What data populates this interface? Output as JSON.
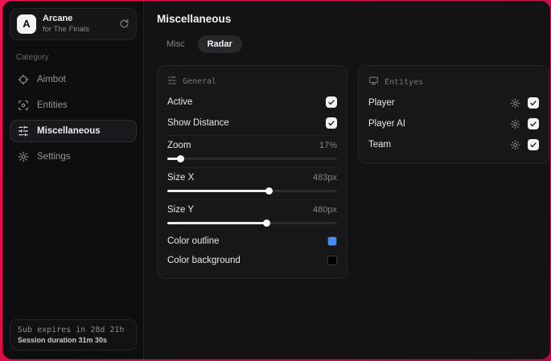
{
  "app": {
    "title": "Arcane",
    "subtitle": "for The Finals",
    "avatar_letter": "A"
  },
  "sidebar": {
    "category_label": "Category",
    "items": [
      {
        "label": "Aimbot",
        "icon": "crosshair-icon",
        "active": false
      },
      {
        "label": "Entities",
        "icon": "scan-icon",
        "active": false
      },
      {
        "label": "Miscellaneous",
        "icon": "sliders-icon",
        "active": true
      },
      {
        "label": "Settings",
        "icon": "gear-icon",
        "active": false
      }
    ],
    "footer": {
      "sub_expiry": "Sub expires in 28d 21h",
      "session_duration": "Session duration 31m 30s"
    }
  },
  "main": {
    "title": "Miscellaneous",
    "tabs": [
      {
        "label": "Misc",
        "active": false
      },
      {
        "label": "Radar",
        "active": true
      }
    ],
    "general": {
      "title": "General",
      "toggles": [
        {
          "label": "Active",
          "checked": true
        },
        {
          "label": "Show Distance",
          "checked": true
        }
      ],
      "sliders": [
        {
          "label": "Zoom",
          "value": "17%",
          "percent": 8
        },
        {
          "label": "Size X",
          "value": "483px",
          "percent": 60
        },
        {
          "label": "Size Y",
          "value": "480px",
          "percent": 59
        }
      ],
      "colors": [
        {
          "label": "Color outline",
          "swatch": "#4a8cf7"
        },
        {
          "label": "Color background",
          "swatch": "#000000"
        }
      ]
    },
    "entities": {
      "title": "Entityes",
      "rows": [
        {
          "label": "Player",
          "checked": true
        },
        {
          "label": "Player AI",
          "checked": true
        },
        {
          "label": "Team",
          "checked": true
        }
      ]
    }
  },
  "colors": {
    "accent_red": "#e01148",
    "checkbox_bg": "#f3f3f5"
  }
}
